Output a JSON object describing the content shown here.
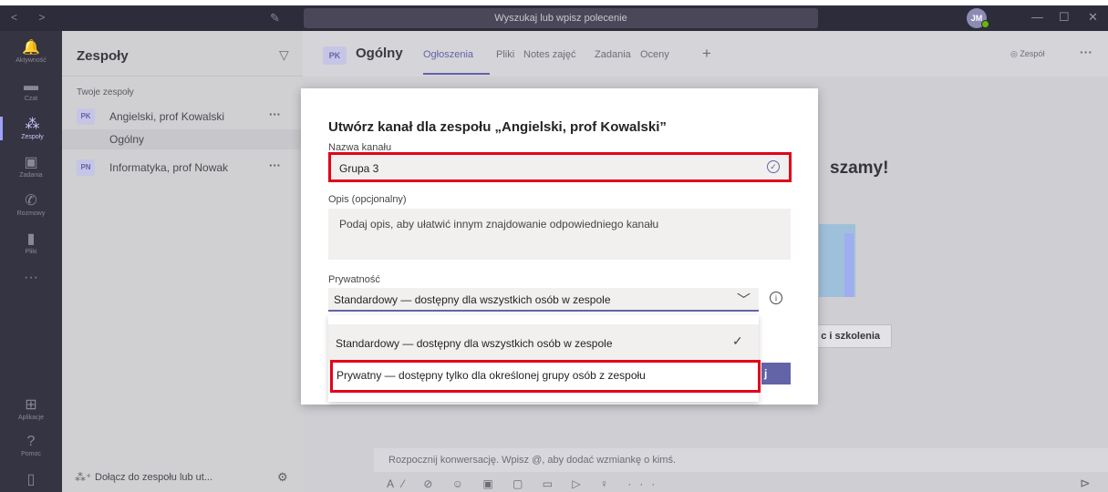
{
  "titlebar": {
    "nav": "< >",
    "search_placeholder": "Wyszukaj lub wpisz polecenie",
    "avatar_initials": "JM",
    "min": "—",
    "max": "☐",
    "close": "✕"
  },
  "rail": {
    "items": [
      {
        "icon": "bell-icon",
        "glyph": "🔔",
        "label": "Aktywność"
      },
      {
        "icon": "chat-icon",
        "glyph": "▬",
        "label": "Czat"
      },
      {
        "icon": "teams-icon",
        "glyph": "⁂",
        "label": "Zespoły"
      },
      {
        "icon": "assignments-icon",
        "glyph": "▣",
        "label": "Zadania"
      },
      {
        "icon": "calls-icon",
        "glyph": "✆",
        "label": "Rozmowy"
      },
      {
        "icon": "files-icon",
        "glyph": "▮",
        "label": "Pliki"
      },
      {
        "icon": "more-icon",
        "glyph": "···",
        "label": ""
      },
      {
        "icon": "apps-icon",
        "glyph": "⊞",
        "label": "Aplikacje"
      },
      {
        "icon": "help-icon",
        "glyph": "?",
        "label": "Pomoc"
      },
      {
        "icon": "device-icon",
        "glyph": "▯",
        "label": ""
      }
    ]
  },
  "panel": {
    "title": "Zespoły",
    "section_label": "Twoje zespoły",
    "teams": [
      {
        "initials": "PK",
        "name": "Angielski, prof Kowalski",
        "more": "···"
      },
      {
        "initials": "PN",
        "name": "Informatyka, prof Nowak",
        "more": "···"
      }
    ],
    "channel": "Ogólny",
    "join_text": "Dołącz do zespołu lub ut..."
  },
  "main": {
    "channel_initials": "PK",
    "channel_name": "Ogólny",
    "tabs": [
      "Ogłoszenia",
      "Pliki",
      "Notes zajęć",
      "Zadania",
      "Oceny"
    ],
    "team_button": "◎ Zespół",
    "more": "···",
    "welcome_partial": "szamy!",
    "training_partial": "c i szkolenia",
    "compose_placeholder": "Rozpocznij konwersację. Wpisz @, aby dodać wzmiankę o kimś.",
    "compose_tools": "A⁄ ⊘ ☺ ▣ ▢ ▭ ▷ ♀ ···"
  },
  "dialog": {
    "title": "Utwórz kanał dla zespołu „Angielski, prof Kowalski”",
    "name_label": "Nazwa kanału",
    "name_value": "Grupa 3",
    "desc_label": "Opis (opcjonalny)",
    "desc_placeholder": "Podaj opis, aby ułatwić innym znajdowanie odpowiedniego kanału",
    "privacy_label": "Prywatność",
    "privacy_selected": "Standardowy — dostępny dla wszystkich osób w zespole",
    "options": [
      "Standardowy — dostępny dla wszystkich osób w zespole",
      "Prywatny — dostępny tylko dla określonej grupy osób z zespołu"
    ],
    "create_partial": "j"
  },
  "colors": {
    "accent": "#6264a7",
    "highlight_red": "#e3001b",
    "titlebar": "#2d2c3b",
    "rail": "#353443"
  }
}
